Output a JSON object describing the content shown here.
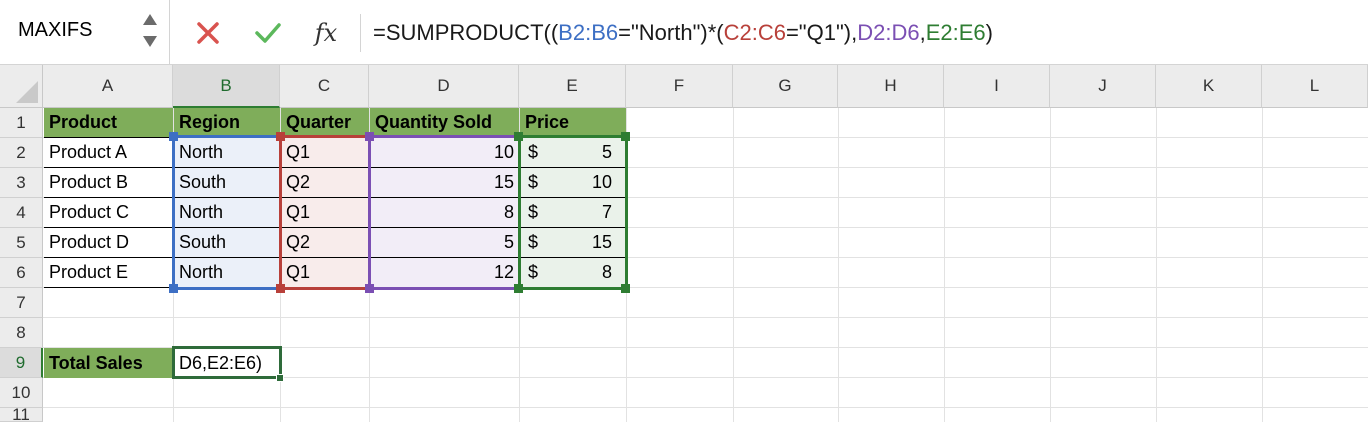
{
  "name_box": {
    "value": "MAXIFS"
  },
  "formula_bar": {
    "fx_label": "fx",
    "formula_parts": [
      {
        "text": "=SUMPRODUCT((",
        "color": "default"
      },
      {
        "text": "B2:B6",
        "color": "blue"
      },
      {
        "text": "=\"North\")*(",
        "color": "default"
      },
      {
        "text": "C2:C6",
        "color": "red"
      },
      {
        "text": "=\"Q1\"),",
        "color": "default"
      },
      {
        "text": "D2:D6",
        "color": "purple"
      },
      {
        "text": ",",
        "color": "default"
      },
      {
        "text": "E2:E6",
        "color": "green"
      },
      {
        "text": ")",
        "color": "default"
      }
    ]
  },
  "columns": [
    "A",
    "B",
    "C",
    "D",
    "E",
    "F",
    "G",
    "H",
    "I",
    "J",
    "K",
    "L"
  ],
  "rows": [
    "1",
    "2",
    "3",
    "4",
    "5",
    "6",
    "7",
    "8",
    "9",
    "10",
    "11"
  ],
  "table": {
    "headers": [
      "Product",
      "Region",
      "Quarter",
      "Quantity Sold",
      "Price"
    ],
    "currency_symbol": "$",
    "rows": [
      {
        "product": "Product A",
        "region": "North",
        "quarter": "Q1",
        "qty": "10",
        "price": "5"
      },
      {
        "product": "Product B",
        "region": "South",
        "quarter": "Q2",
        "qty": "15",
        "price": "10"
      },
      {
        "product": "Product C",
        "region": "North",
        "quarter": "Q1",
        "qty": "8",
        "price": "7"
      },
      {
        "product": "Product D",
        "region": "South",
        "quarter": "Q2",
        "qty": "5",
        "price": "15"
      },
      {
        "product": "Product E",
        "region": "North",
        "quarter": "Q1",
        "qty": "12",
        "price": "8"
      }
    ]
  },
  "total": {
    "label": "Total Sales",
    "edit_text": "D6,E2:E6)"
  },
  "colors": {
    "header_fill": "#7fad5a",
    "range_blue": "#3d6fc4",
    "range_red": "#b8403a",
    "range_purple": "#7b4fb3",
    "range_green": "#2e7d32",
    "active_border": "#2e6b3a"
  }
}
